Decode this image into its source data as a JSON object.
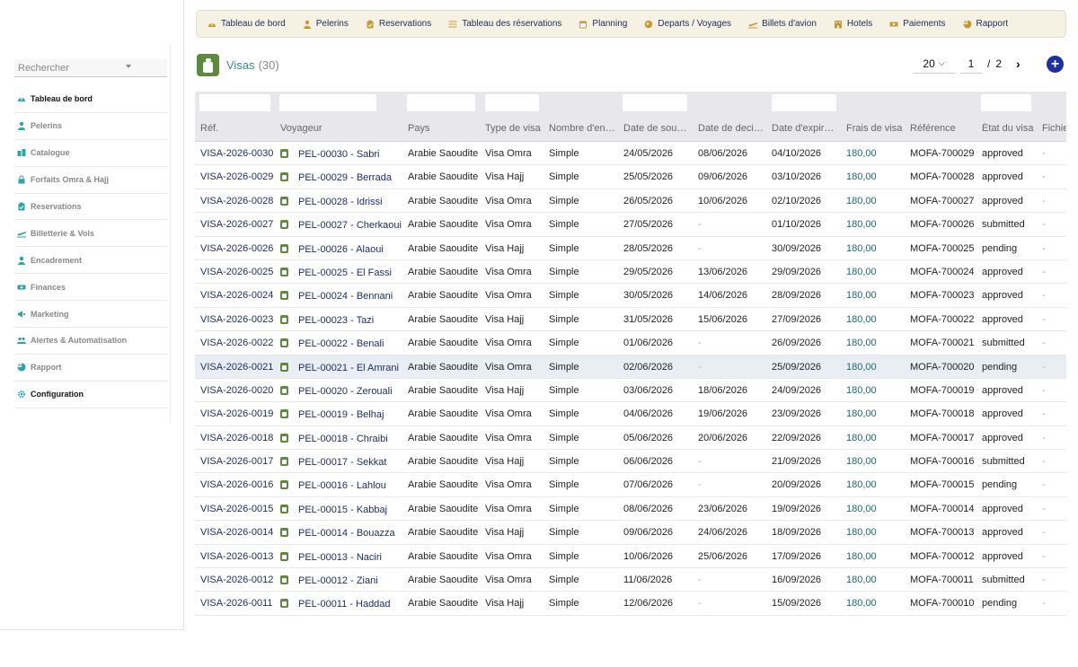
{
  "sidebar": {
    "search_placeholder": "Rechercher",
    "items": [
      {
        "label": "Tableau de bord",
        "icon": "dashboard-icon",
        "active": true
      },
      {
        "label": "Pelerins",
        "icon": "user-icon"
      },
      {
        "label": "Catalogue",
        "icon": "catalog-icon"
      },
      {
        "label": "Forfaits Omra & Hajj",
        "icon": "lock-icon"
      },
      {
        "label": "Reservations",
        "icon": "clipboard-icon"
      },
      {
        "label": "Billetterie & Vols",
        "icon": "plane-icon"
      },
      {
        "label": "Encadrement",
        "icon": "user-icon"
      },
      {
        "label": "Finances",
        "icon": "money-icon"
      },
      {
        "label": "Marketing",
        "icon": "megaphone-icon"
      },
      {
        "label": "Alertes & Automatisation",
        "icon": "users-icon"
      },
      {
        "label": "Rapport",
        "icon": "report-icon"
      },
      {
        "label": "Configuration",
        "icon": "gear-icon",
        "active": true
      }
    ]
  },
  "topnav": {
    "items": [
      {
        "label": "Tableau de bord",
        "icon": "dashboard-icon"
      },
      {
        "label": "Pelerins",
        "icon": "user-icon"
      },
      {
        "label": "Reservations",
        "icon": "clipboard-icon"
      },
      {
        "label": "Tableau des réservations",
        "icon": "list-icon"
      },
      {
        "label": "Planning",
        "icon": "calendar-icon"
      },
      {
        "label": "Departs / Voyages",
        "icon": "globe-icon"
      },
      {
        "label": "Billets d'avion",
        "icon": "plane-icon"
      },
      {
        "label": "Hotels",
        "icon": "hotel-icon"
      },
      {
        "label": "Paiements",
        "icon": "money-icon"
      },
      {
        "label": "Rapport",
        "icon": "report-icon"
      }
    ]
  },
  "page": {
    "title": "Visas",
    "count": "(30)"
  },
  "pager": {
    "per_page": "20",
    "current": "1",
    "separator": "/",
    "total": "2",
    "next": "›",
    "add": "+"
  },
  "table": {
    "columns": [
      "Réf.",
      "Voyageur",
      "Pays",
      "Type de visa",
      "Nombre d'en…",
      "Date de sou…",
      "Date de deci…",
      "Date d'expir…",
      "Frais de visa",
      "Référence",
      "État du visa",
      "Fichie"
    ],
    "rows": [
      [
        "VISA-2026-0030",
        "PEL-00030 - Sabri",
        "Arabie Saoudite",
        "Visa Omra",
        "Simple",
        "24/05/2026",
        "08/06/2026",
        "04/10/2026",
        "180,00",
        "MOFA-700029",
        "approved",
        "-"
      ],
      [
        "VISA-2026-0029",
        "PEL-00029 - Berrada",
        "Arabie Saoudite",
        "Visa Hajj",
        "Simple",
        "25/05/2026",
        "09/06/2026",
        "03/10/2026",
        "180,00",
        "MOFA-700028",
        "approved",
        "-"
      ],
      [
        "VISA-2026-0028",
        "PEL-00028 - Idrissi",
        "Arabie Saoudite",
        "Visa Omra",
        "Simple",
        "26/05/2026",
        "10/06/2026",
        "02/10/2026",
        "180,00",
        "MOFA-700027",
        "approved",
        "-"
      ],
      [
        "VISA-2026-0027",
        "PEL-00027 - Cherkaoui",
        "Arabie Saoudite",
        "Visa Omra",
        "Simple",
        "27/05/2026",
        "-",
        "01/10/2026",
        "180,00",
        "MOFA-700026",
        "submitted",
        "-"
      ],
      [
        "VISA-2026-0026",
        "PEL-00026 - Alaoui",
        "Arabie Saoudite",
        "Visa Hajj",
        "Simple",
        "28/05/2026",
        "-",
        "30/09/2026",
        "180,00",
        "MOFA-700025",
        "pending",
        "-"
      ],
      [
        "VISA-2026-0025",
        "PEL-00025 - El Fassi",
        "Arabie Saoudite",
        "Visa Omra",
        "Simple",
        "29/05/2026",
        "13/06/2026",
        "29/09/2026",
        "180,00",
        "MOFA-700024",
        "approved",
        "-"
      ],
      [
        "VISA-2026-0024",
        "PEL-00024 - Bennani",
        "Arabie Saoudite",
        "Visa Omra",
        "Simple",
        "30/05/2026",
        "14/06/2026",
        "28/09/2026",
        "180,00",
        "MOFA-700023",
        "approved",
        "-"
      ],
      [
        "VISA-2026-0023",
        "PEL-00023 - Tazi",
        "Arabie Saoudite",
        "Visa Hajj",
        "Simple",
        "31/05/2026",
        "15/06/2026",
        "27/09/2026",
        "180,00",
        "MOFA-700022",
        "approved",
        "-"
      ],
      [
        "VISA-2026-0022",
        "PEL-00022 - Benali",
        "Arabie Saoudite",
        "Visa Omra",
        "Simple",
        "01/06/2026",
        "-",
        "26/09/2026",
        "180,00",
        "MOFA-700021",
        "submitted",
        "-"
      ],
      [
        "VISA-2026-0021",
        "PEL-00021 - El Amrani",
        "Arabie Saoudite",
        "Visa Omra",
        "Simple",
        "02/06/2026",
        "-",
        "25/09/2026",
        "180,00",
        "MOFA-700020",
        "pending",
        "-"
      ],
      [
        "VISA-2026-0020",
        "PEL-00020 - Zerouali",
        "Arabie Saoudite",
        "Visa Hajj",
        "Simple",
        "03/06/2026",
        "18/06/2026",
        "24/09/2026",
        "180,00",
        "MOFA-700019",
        "approved",
        "-"
      ],
      [
        "VISA-2026-0019",
        "PEL-00019 - Belhaj",
        "Arabie Saoudite",
        "Visa Omra",
        "Simple",
        "04/06/2026",
        "19/06/2026",
        "23/09/2026",
        "180,00",
        "MOFA-700018",
        "approved",
        "-"
      ],
      [
        "VISA-2026-0018",
        "PEL-00018 - Chraibi",
        "Arabie Saoudite",
        "Visa Omra",
        "Simple",
        "05/06/2026",
        "20/06/2026",
        "22/09/2026",
        "180,00",
        "MOFA-700017",
        "approved",
        "-"
      ],
      [
        "VISA-2026-0017",
        "PEL-00017 - Sekkat",
        "Arabie Saoudite",
        "Visa Hajj",
        "Simple",
        "06/06/2026",
        "-",
        "21/09/2026",
        "180,00",
        "MOFA-700016",
        "submitted",
        "-"
      ],
      [
        "VISA-2026-0016",
        "PEL-00016 - Lahlou",
        "Arabie Saoudite",
        "Visa Omra",
        "Simple",
        "07/06/2026",
        "-",
        "20/09/2026",
        "180,00",
        "MOFA-700015",
        "pending",
        "-"
      ],
      [
        "VISA-2026-0015",
        "PEL-00015 - Kabbaj",
        "Arabie Saoudite",
        "Visa Omra",
        "Simple",
        "08/06/2026",
        "23/06/2026",
        "19/09/2026",
        "180,00",
        "MOFA-700014",
        "approved",
        "-"
      ],
      [
        "VISA-2026-0014",
        "PEL-00014 - Bouazza",
        "Arabie Saoudite",
        "Visa Hajj",
        "Simple",
        "09/06/2026",
        "24/06/2026",
        "18/09/2026",
        "180,00",
        "MOFA-700013",
        "approved",
        "-"
      ],
      [
        "VISA-2026-0013",
        "PEL-00013 - Naciri",
        "Arabie Saoudite",
        "Visa Omra",
        "Simple",
        "10/06/2026",
        "25/06/2026",
        "17/09/2026",
        "180,00",
        "MOFA-700012",
        "approved",
        "-"
      ],
      [
        "VISA-2026-0012",
        "PEL-00012 - Ziani",
        "Arabie Saoudite",
        "Visa Omra",
        "Simple",
        "11/06/2026",
        "-",
        "16/09/2026",
        "180,00",
        "MOFA-700011",
        "submitted",
        "-"
      ],
      [
        "VISA-2026-0011",
        "PEL-00011 - Haddad",
        "Arabie Saoudite",
        "Visa Hajj",
        "Simple",
        "12/06/2026",
        "-",
        "15/09/2026",
        "180,00",
        "MOFA-700010",
        "pending",
        "-"
      ]
    ]
  },
  "colors": {
    "link": "#1d2a5c",
    "fee": "#1b6a6f",
    "title": "#3a8a8a",
    "topnav_bg": "#f5f1e3",
    "menu_icon": "#2aa6a6",
    "nav_icon": "#c79a2e",
    "add_button": "#1c2ea8",
    "visa_icon": "#5d8a3b",
    "highlight_row": "#e9eef5"
  }
}
